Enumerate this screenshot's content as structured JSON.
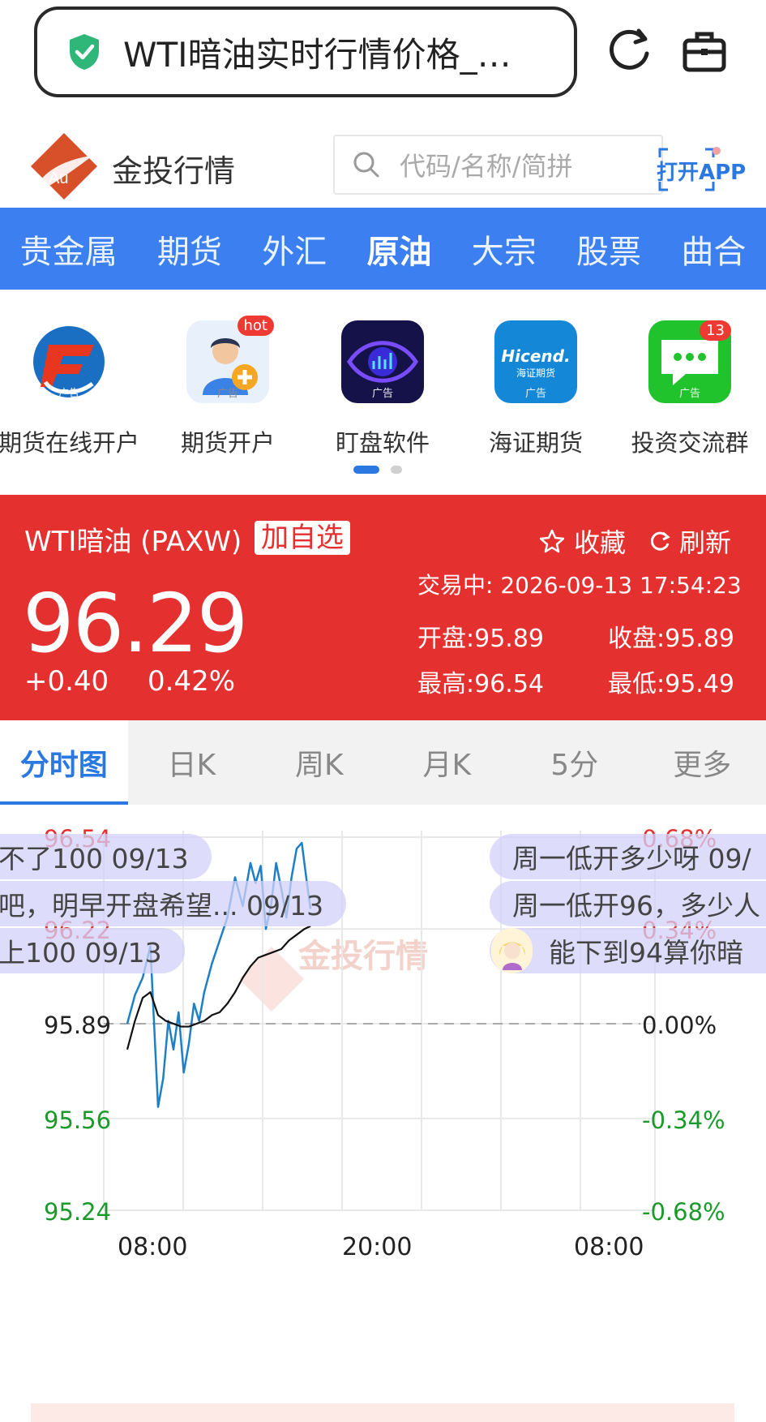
{
  "browser": {
    "url_title": "WTI暗油实时行情价格_…",
    "reload_icon": "reload-icon",
    "bag_icon": "briefcase-icon"
  },
  "header": {
    "brand": "金投行情",
    "logo_text": "Au",
    "search_placeholder": "代码/名称/简拼",
    "open_app": "打开APP"
  },
  "nav": {
    "items": [
      {
        "label": "贵金属"
      },
      {
        "label": "期货"
      },
      {
        "label": "外汇"
      },
      {
        "label": "原油"
      },
      {
        "label": "大宗"
      },
      {
        "label": "股票"
      },
      {
        "label": "曲合"
      }
    ],
    "active_index": 3
  },
  "apps": {
    "ad_tag": "广告",
    "items": [
      {
        "label": "期货在线开户",
        "icon": "futures-online-icon"
      },
      {
        "label": "期货开户",
        "icon": "futures-account-icon",
        "badge": "hot"
      },
      {
        "label": "盯盘软件",
        "icon": "eye-chart-icon"
      },
      {
        "label": "海证期货",
        "icon": "hicend-icon",
        "icon_text": "Hicend.",
        "icon_sub": "海证期货"
      },
      {
        "label": "投资交流群",
        "icon": "chat-icon",
        "badge": "13"
      }
    ],
    "page_count": 2,
    "active_page": 0
  },
  "quote": {
    "name": "WTI暗油 (PAXW)",
    "add_watch": "加自选",
    "favorite": "收藏",
    "refresh": "刷新",
    "status": "交易中: 2026-09-13 17:54:23",
    "price": "96.29",
    "change": "+0.40",
    "change_pct": "0.42%",
    "open": "开盘:95.89",
    "close": "收盘:95.89",
    "high": "最高:96.54",
    "low": "最低:95.49",
    "colors": {
      "up": "#e53030",
      "down": "#1a9a2a",
      "accent": "#2a78e0"
    }
  },
  "tabs": [
    {
      "label": "分时图"
    },
    {
      "label": "日K"
    },
    {
      "label": "周K"
    },
    {
      "label": "月K"
    },
    {
      "label": "5分"
    },
    {
      "label": "更多"
    }
  ],
  "chart": {
    "watermark": "金投行情",
    "comments_left": [
      "不了100 09/13",
      "吧，明早开盘希望... 09/13",
      "上100 09/13"
    ],
    "comments_right": [
      "周一低开多少呀 09/",
      "周一低开96，多少人",
      "能下到94算你暗"
    ]
  },
  "chart_data": {
    "type": "line",
    "title": "",
    "xlabel": "",
    "ylabel": "",
    "ylim": [
      95.24,
      96.54
    ],
    "y_ticks_left": [
      "96.54",
      "96.22",
      "95.89",
      "95.56",
      "95.24"
    ],
    "y_ticks_right": [
      "0.68%",
      "0.34%",
      "0.00%",
      "-0.34%",
      "-0.68%"
    ],
    "x_ticks": [
      "08:00",
      "20:00",
      "08:00"
    ],
    "reference_value": 95.89,
    "series": [
      {
        "x": [
          "06:00",
          "06:30",
          "07:00",
          "07:30",
          "08:00",
          "08:20",
          "08:40",
          "09:00",
          "09:20",
          "09:40",
          "10:00",
          "10:20",
          "10:40",
          "11:00",
          "11:30",
          "12:00",
          "12:30",
          "13:00",
          "13:30",
          "14:00",
          "14:20",
          "14:40",
          "15:00",
          "15:20",
          "15:40",
          "16:00",
          "16:20",
          "16:40",
          "17:00",
          "17:20",
          "17:40",
          "17:54"
        ],
        "values": [
          95.89,
          95.99,
          96.05,
          96.16,
          95.6,
          95.7,
          95.9,
          95.8,
          95.93,
          95.72,
          95.82,
          95.96,
          95.9,
          96.0,
          96.1,
          96.18,
          96.26,
          96.4,
          96.3,
          96.45,
          96.38,
          96.44,
          96.22,
          96.3,
          96.45,
          96.36,
          96.26,
          96.4,
          96.5,
          96.52,
          96.38,
          96.29
        ]
      },
      {
        "x": [
          "06:00",
          "06:30",
          "07:00",
          "07:30",
          "08:00",
          "08:30",
          "09:00",
          "09:30",
          "10:00",
          "10:30",
          "11:00",
          "11:30",
          "12:00",
          "12:30",
          "13:00",
          "13:30",
          "14:00",
          "14:30",
          "15:00",
          "15:30",
          "16:00",
          "16:30",
          "17:00",
          "17:30",
          "17:54"
        ],
        "values": [
          95.8,
          95.9,
          95.98,
          96.0,
          95.92,
          95.9,
          95.89,
          95.88,
          95.88,
          95.89,
          95.9,
          95.92,
          95.93,
          95.96,
          96.0,
          96.05,
          96.09,
          96.12,
          96.13,
          96.14,
          96.15,
          96.18,
          96.2,
          96.22,
          96.23
        ]
      }
    ],
    "colors": [
      "#1f7fc4",
      "#111111"
    ],
    "grid": true
  }
}
